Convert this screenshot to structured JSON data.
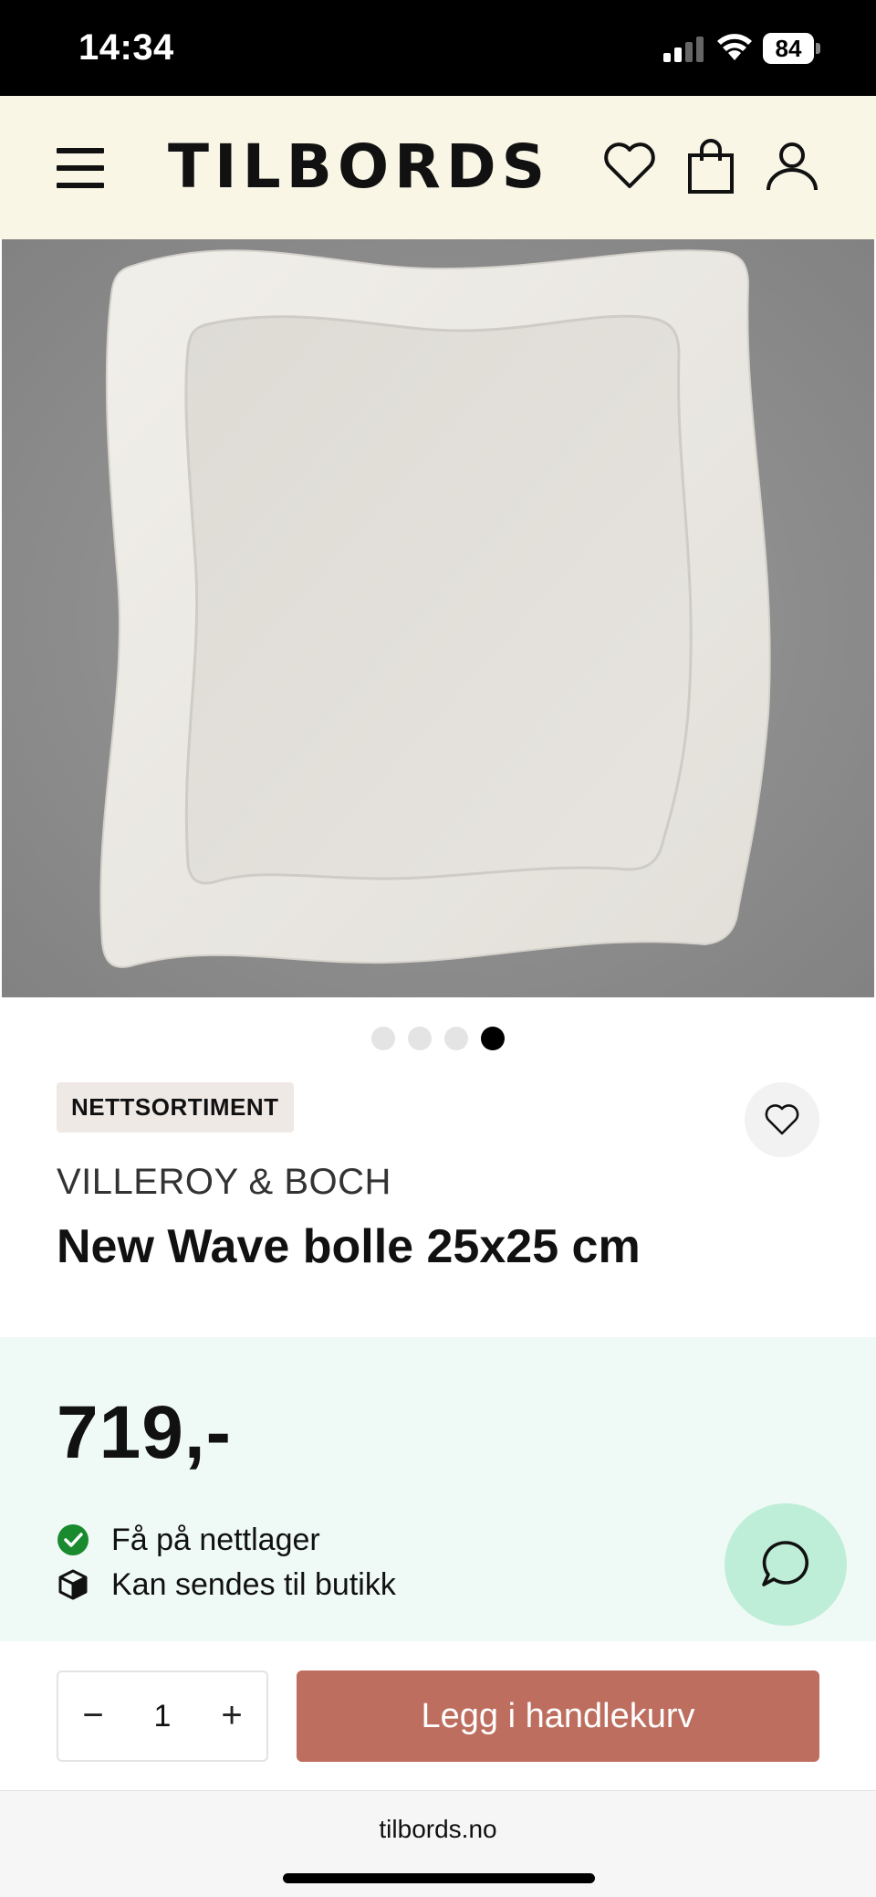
{
  "status_bar": {
    "time": "14:34",
    "battery": "84",
    "icons": [
      "signal-icon",
      "wifi-icon",
      "battery-icon"
    ]
  },
  "header": {
    "logo": "TILBORDS",
    "icons": [
      "menu-icon",
      "heart-icon",
      "shopping-bag-icon",
      "user-icon"
    ]
  },
  "gallery": {
    "image_count": 4,
    "active_index": 3
  },
  "product": {
    "badge": "NETTSORTIMENT",
    "brand": "VILLEROY & BOCH",
    "title": "New Wave bolle 25x25 cm",
    "price": "719,-",
    "availability": [
      {
        "icon": "check-circle-icon",
        "text": "Få på nettlager"
      },
      {
        "icon": "box-icon",
        "text": "Kan sendes til butikk"
      }
    ]
  },
  "cart": {
    "minus": "−",
    "quantity": "1",
    "plus": "+",
    "add_label": "Legg i handlekurv"
  },
  "browser": {
    "url": "tilbords.no"
  },
  "colors": {
    "header_bg": "#faf6e6",
    "price_bg": "#effaf6",
    "cta": "#bd6e5f",
    "chat": "#bfeed8",
    "check": "#1a8a2e"
  }
}
